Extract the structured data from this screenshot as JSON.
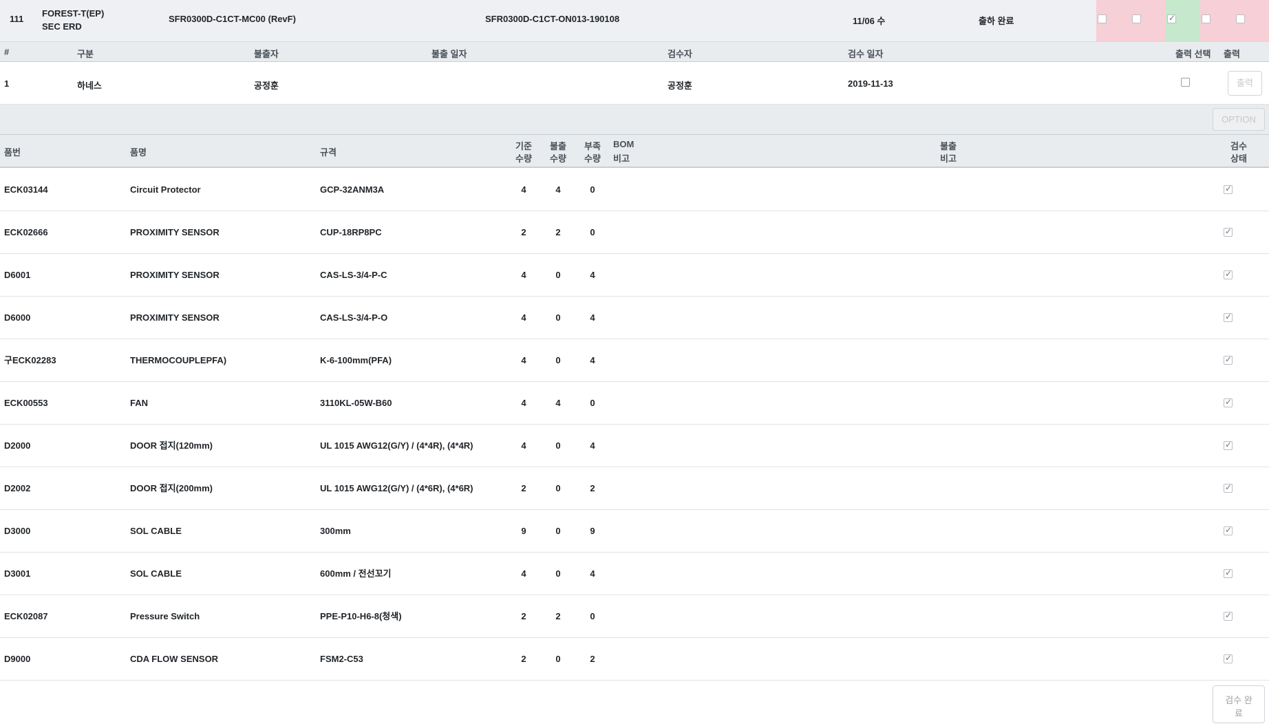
{
  "order": {
    "no": "111",
    "customer_line1": "FOREST-T(EP)",
    "customer_line2": "SEC ERD",
    "model": "SFR0300D-C1CT-MC00 (RevF)",
    "order_no": "SFR0300D-C1CT-ON013-190108",
    "date": "11/06 수",
    "status": "출하 완료",
    "step_checks": [
      false,
      false,
      true,
      false,
      false
    ]
  },
  "issue_table": {
    "headers": {
      "no": "#",
      "category": "구분",
      "issuer": "불출자",
      "issue_date": "불출 일자",
      "inspector": "검수자",
      "inspect_date": "검수 일자",
      "print_select": "출력 선택",
      "print": "출력"
    },
    "rows": [
      {
        "no": "1",
        "category": "하네스",
        "issuer": "공정훈",
        "issue_date": "",
        "inspector": "공정훈",
        "inspect_date": "2019-11-13",
        "print_selected": false,
        "print_label": "출력"
      }
    ]
  },
  "option_button": "OPTION",
  "items_table": {
    "headers": {
      "part_no": "품번",
      "part_name": "품명",
      "spec": "규격",
      "std_qty_1": "기준",
      "std_qty_2": "수량",
      "issue_qty_1": "불출",
      "issue_qty_2": "수량",
      "short_qty_1": "부족",
      "short_qty_2": "수량",
      "bom_note_1": "BOM",
      "bom_note_2": "비고",
      "issue_note_1": "불출",
      "issue_note_2": "비고",
      "inspect_status_1": "검수",
      "inspect_status_2": "상태"
    },
    "rows": [
      {
        "part_no": "ECK03144",
        "part_name": "Circuit Protector",
        "spec": "GCP-32ANM3A",
        "std_qty": "4",
        "issue_qty": "4",
        "short_qty": "0",
        "checked": true
      },
      {
        "part_no": "ECK02666",
        "part_name": "PROXIMITY SENSOR",
        "spec": "CUP-18RP8PC",
        "std_qty": "2",
        "issue_qty": "2",
        "short_qty": "0",
        "checked": true
      },
      {
        "part_no": "D6001",
        "part_name": "PROXIMITY SENSOR",
        "spec": "CAS-LS-3/4-P-C",
        "std_qty": "4",
        "issue_qty": "0",
        "short_qty": "4",
        "checked": true
      },
      {
        "part_no": "D6000",
        "part_name": "PROXIMITY SENSOR",
        "spec": "CAS-LS-3/4-P-O",
        "std_qty": "4",
        "issue_qty": "0",
        "short_qty": "4",
        "checked": true
      },
      {
        "part_no": "구ECK02283",
        "part_name": "THERMOCOUPLEPFA)",
        "spec": "K-6-100mm(PFA)",
        "std_qty": "4",
        "issue_qty": "0",
        "short_qty": "4",
        "checked": true
      },
      {
        "part_no": "ECK00553",
        "part_name": "FAN",
        "spec": "3110KL-05W-B60",
        "std_qty": "4",
        "issue_qty": "4",
        "short_qty": "0",
        "checked": true
      },
      {
        "part_no": "D2000",
        "part_name": "DOOR 접지(120mm)",
        "spec": "UL 1015 AWG12(G/Y) / (4*4R), (4*4R)",
        "std_qty": "4",
        "issue_qty": "0",
        "short_qty": "4",
        "checked": true
      },
      {
        "part_no": "D2002",
        "part_name": "DOOR 접지(200mm)",
        "spec": "UL 1015 AWG12(G/Y) / (4*6R), (4*6R)",
        "std_qty": "2",
        "issue_qty": "0",
        "short_qty": "2",
        "checked": true
      },
      {
        "part_no": "D3000",
        "part_name": "SOL CABLE",
        "spec": "300mm",
        "std_qty": "9",
        "issue_qty": "0",
        "short_qty": "9",
        "checked": true
      },
      {
        "part_no": "D3001",
        "part_name": "SOL CABLE",
        "spec": "600mm / 전선꼬기",
        "std_qty": "4",
        "issue_qty": "0",
        "short_qty": "4",
        "checked": true
      },
      {
        "part_no": "ECK02087",
        "part_name": "Pressure Switch",
        "spec": "PPE-P10-H6-8(청색)",
        "std_qty": "2",
        "issue_qty": "2",
        "short_qty": "0",
        "checked": true
      },
      {
        "part_no": "D9000",
        "part_name": "CDA FLOW SENSOR",
        "spec": "FSM2-C53",
        "std_qty": "2",
        "issue_qty": "0",
        "short_qty": "2",
        "checked": true
      }
    ]
  },
  "complete_button": {
    "line1": "검수 완",
    "line2": "료"
  }
}
